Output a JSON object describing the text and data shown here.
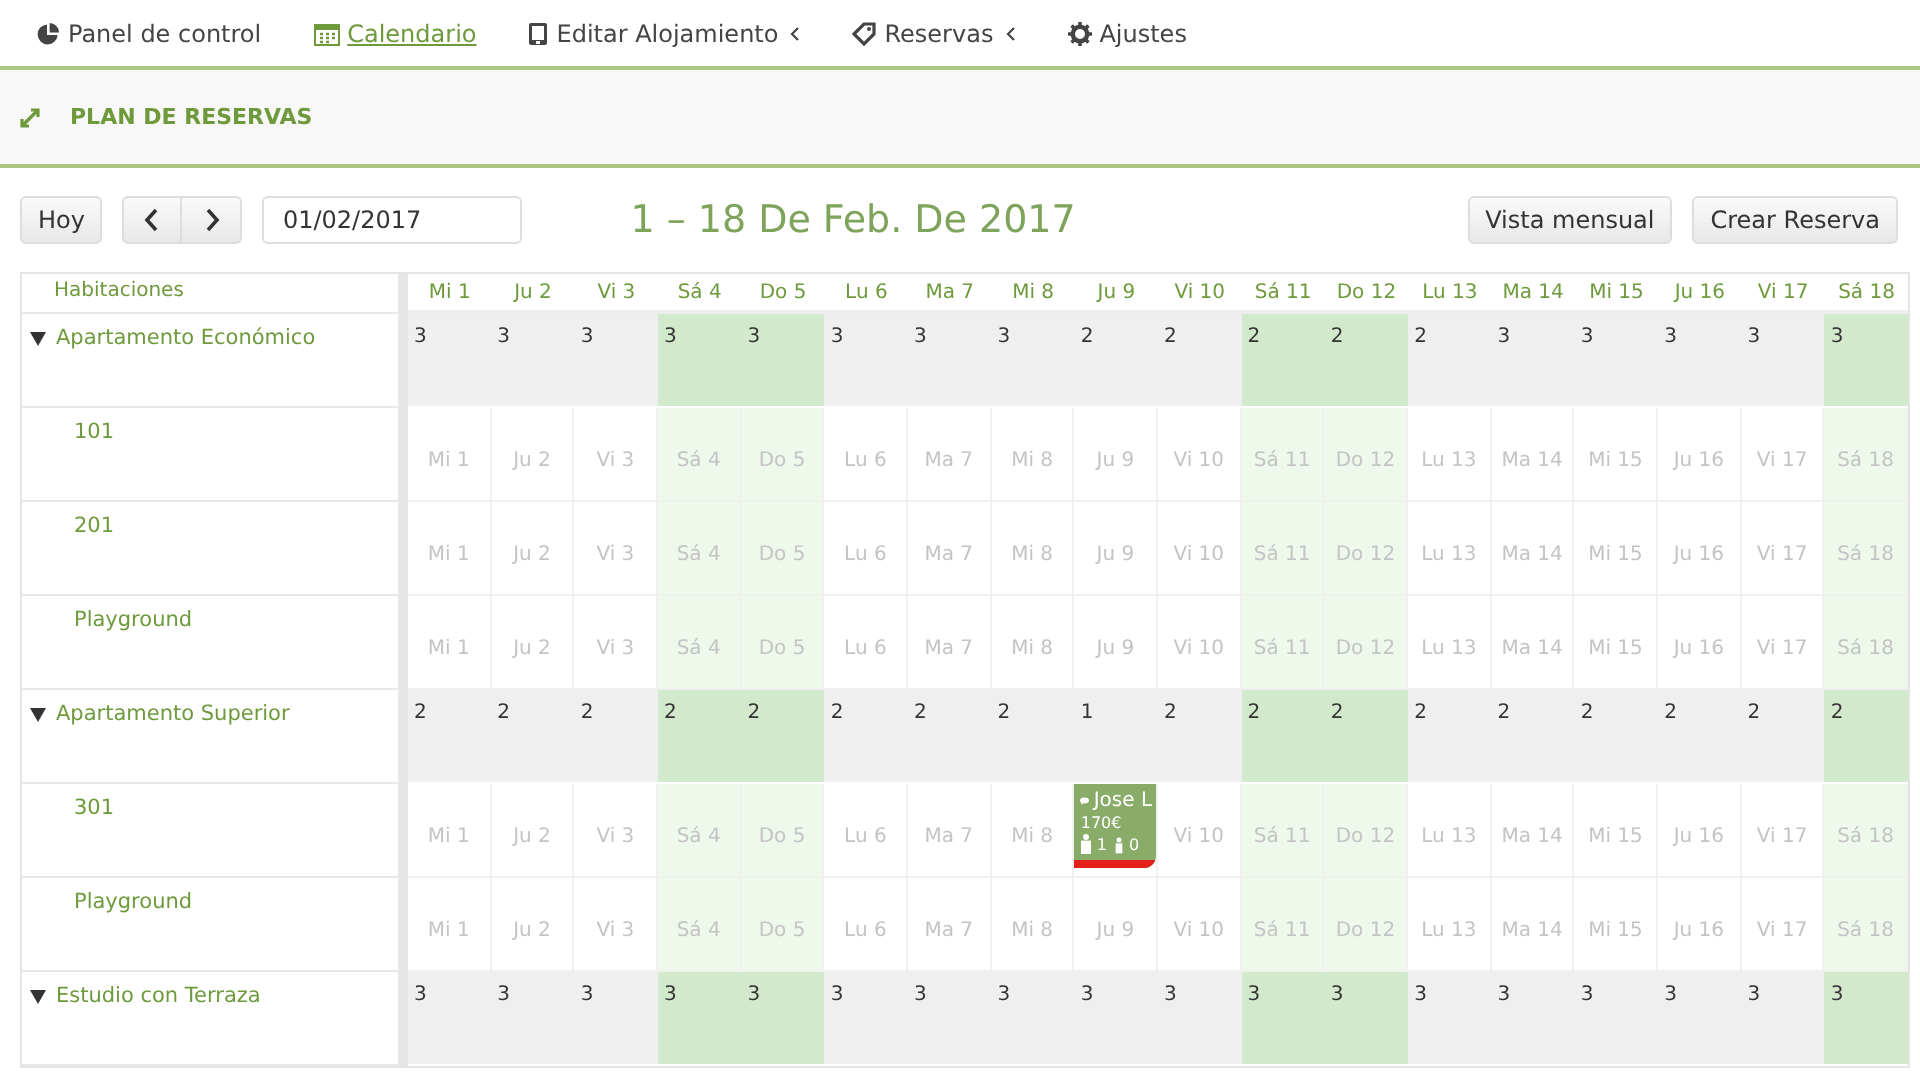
{
  "nav": [
    {
      "label": "Panel de control",
      "selected": false,
      "submenu": false
    },
    {
      "label": "Calendario",
      "selected": true,
      "submenu": false
    },
    {
      "label": "Editar Alojamiento",
      "selected": false,
      "submenu": true
    },
    {
      "label": "Reservas",
      "selected": false,
      "submenu": true
    },
    {
      "label": "Ajustes",
      "selected": false,
      "submenu": false
    }
  ],
  "section_title": "PLAN DE RESERVAS",
  "toolbar": {
    "today": "Hoy",
    "date": "01/02/2017",
    "range": "1 – 18 De Feb. De 2017",
    "buttons": [
      "Vista mensual",
      "Crear Reserva"
    ]
  },
  "rooms_heading": "Habitaciones",
  "days": [
    {
      "label": "Mi 1",
      "weekend": false
    },
    {
      "label": "Ju 2",
      "weekend": false
    },
    {
      "label": "Vi 3",
      "weekend": false
    },
    {
      "label": "Sá 4",
      "weekend": true
    },
    {
      "label": "Do 5",
      "weekend": true
    },
    {
      "label": "Lu 6",
      "weekend": false
    },
    {
      "label": "Ma 7",
      "weekend": false
    },
    {
      "label": "Mi 8",
      "weekend": false
    },
    {
      "label": "Ju 9",
      "weekend": false
    },
    {
      "label": "Vi 10",
      "weekend": false
    },
    {
      "label": "Sá 11",
      "weekend": true
    },
    {
      "label": "Do 12",
      "weekend": true
    },
    {
      "label": "Lu 13",
      "weekend": false
    },
    {
      "label": "Ma 14",
      "weekend": false
    },
    {
      "label": "Mi 15",
      "weekend": false
    },
    {
      "label": "Ju 16",
      "weekend": false
    },
    {
      "label": "Vi 17",
      "weekend": false
    },
    {
      "label": "Sá 18",
      "weekend": true
    }
  ],
  "groups": [
    {
      "name": "Apartamento Económico",
      "expanded": true,
      "availability": [
        "3",
        "3",
        "3",
        "3",
        "3",
        "3",
        "3",
        "3",
        "2",
        "2",
        "2",
        "2",
        "2",
        "3",
        "3",
        "3",
        "3",
        "3"
      ],
      "rooms": [
        {
          "name": "101",
          "cells": [
            {
              "kind": "day",
              "label": "Mi 1"
            },
            {
              "kind": "day",
              "label": "Ju 2"
            },
            {
              "kind": "day",
              "label": "Vi 3"
            },
            {
              "kind": "day",
              "label": "Sá 4"
            },
            {
              "kind": "day",
              "label": "Do 5"
            },
            {
              "kind": "day",
              "label": "Lu 6"
            },
            {
              "kind": "day",
              "label": "Ma 7"
            },
            {
              "kind": "day",
              "label": "Mi 8"
            },
            {
              "kind": "day",
              "label": "Ju 9"
            },
            {
              "kind": "day",
              "label": "Vi 10"
            },
            {
              "kind": "day",
              "label": "Sá 11"
            },
            {
              "kind": "day",
              "label": "Do 12"
            },
            {
              "kind": "day",
              "label": "Lu 13"
            },
            {
              "kind": "day",
              "label": "Ma 14"
            },
            {
              "kind": "day",
              "label": "Mi 15"
            },
            {
              "kind": "day",
              "label": "Ju 16"
            },
            {
              "kind": "day",
              "label": "Vi 17"
            },
            {
              "kind": "day",
              "label": "Sá 18"
            }
          ]
        },
        {
          "name": "201",
          "cells": [
            {
              "kind": "day",
              "label": "Mi 1"
            },
            {
              "kind": "day",
              "label": "Ju 2"
            },
            {
              "kind": "day",
              "label": "Vi 3"
            },
            {
              "kind": "day",
              "label": "Sá 4"
            },
            {
              "kind": "day",
              "label": "Do 5"
            },
            {
              "kind": "day",
              "label": "Lu 6"
            },
            {
              "kind": "day",
              "label": "Ma 7"
            },
            {
              "kind": "day",
              "label": "Mi 8"
            },
            {
              "kind": "day",
              "label": "Ju 9"
            },
            {
              "kind": "day",
              "label": "Vi 10"
            },
            {
              "kind": "day",
              "label": "Sá 11"
            },
            {
              "kind": "day",
              "label": "Do 12"
            },
            {
              "kind": "day",
              "label": "Lu 13"
            },
            {
              "kind": "day",
              "label": "Ma 14"
            },
            {
              "kind": "day",
              "label": "Mi 15"
            },
            {
              "kind": "day",
              "label": "Ju 16"
            },
            {
              "kind": "day",
              "label": "Vi 17"
            },
            {
              "kind": "day",
              "label": "Sá 18"
            }
          ]
        },
        {
          "name": "Playground",
          "cells": [
            {
              "kind": "day",
              "label": "Mi 1"
            },
            {
              "kind": "day",
              "label": "Ju 2"
            },
            {
              "kind": "day",
              "label": "Vi 3"
            },
            {
              "kind": "day",
              "label": "Sá 4"
            },
            {
              "kind": "day",
              "label": "Do 5"
            },
            {
              "kind": "day",
              "label": "Lu 6"
            },
            {
              "kind": "day",
              "label": "Ma 7"
            },
            {
              "kind": "day",
              "label": "Mi 8"
            },
            {
              "kind": "day",
              "label": "Ju 9"
            },
            {
              "kind": "day",
              "label": "Vi 10"
            },
            {
              "kind": "day",
              "label": "Sá 11"
            },
            {
              "kind": "day",
              "label": "Do 12"
            },
            {
              "kind": "day",
              "label": "Lu 13"
            },
            {
              "kind": "day",
              "label": "Ma 14"
            },
            {
              "kind": "day",
              "label": "Mi 15"
            },
            {
              "kind": "day",
              "label": "Ju 16"
            },
            {
              "kind": "day",
              "label": "Vi 17"
            },
            {
              "kind": "day",
              "label": "Sá 18"
            }
          ]
        }
      ]
    },
    {
      "name": "Apartamento Superior",
      "expanded": true,
      "availability": [
        "2",
        "2",
        "2",
        "2",
        "2",
        "2",
        "2",
        "2",
        "1",
        "2",
        "2",
        "2",
        "2",
        "2",
        "2",
        "2",
        "2",
        "2"
      ],
      "rooms": [
        {
          "name": "301",
          "cells": [
            {
              "kind": "day",
              "label": "Mi 1"
            },
            {
              "kind": "day",
              "label": "Ju 2"
            },
            {
              "kind": "day",
              "label": "Vi 3"
            },
            {
              "kind": "day",
              "label": "Sá 4"
            },
            {
              "kind": "day",
              "label": "Do 5"
            },
            {
              "kind": "day",
              "label": "Lu 6"
            },
            {
              "kind": "day",
              "label": "Ma 7"
            },
            {
              "kind": "day",
              "label": "Mi 8"
            },
            {
              "kind": "booking",
              "guest": "Jose L",
              "price": "170€",
              "adults": "1",
              "children": "0"
            },
            {
              "kind": "day",
              "label": "Vi 10"
            },
            {
              "kind": "day",
              "label": "Sá 11"
            },
            {
              "kind": "day",
              "label": "Do 12"
            },
            {
              "kind": "day",
              "label": "Lu 13"
            },
            {
              "kind": "day",
              "label": "Ma 14"
            },
            {
              "kind": "day",
              "label": "Mi 15"
            },
            {
              "kind": "day",
              "label": "Ju 16"
            },
            {
              "kind": "day",
              "label": "Vi 17"
            },
            {
              "kind": "day",
              "label": "Sá 18"
            }
          ]
        },
        {
          "name": "Playground",
          "cells": [
            {
              "kind": "day",
              "label": "Mi 1"
            },
            {
              "kind": "day",
              "label": "Ju 2"
            },
            {
              "kind": "day",
              "label": "Vi 3"
            },
            {
              "kind": "day",
              "label": "Sá 4"
            },
            {
              "kind": "day",
              "label": "Do 5"
            },
            {
              "kind": "day",
              "label": "Lu 6"
            },
            {
              "kind": "day",
              "label": "Ma 7"
            },
            {
              "kind": "day",
              "label": "Mi 8"
            },
            {
              "kind": "day",
              "label": "Ju 9"
            },
            {
              "kind": "day",
              "label": "Vi 10"
            },
            {
              "kind": "day",
              "label": "Sá 11"
            },
            {
              "kind": "day",
              "label": "Do 12"
            },
            {
              "kind": "day",
              "label": "Lu 13"
            },
            {
              "kind": "day",
              "label": "Ma 14"
            },
            {
              "kind": "day",
              "label": "Mi 15"
            },
            {
              "kind": "day",
              "label": "Ju 16"
            },
            {
              "kind": "day",
              "label": "Vi 17"
            },
            {
              "kind": "day",
              "label": "Sá 18"
            }
          ]
        }
      ]
    },
    {
      "name": "Estudio con Terraza",
      "expanded": true,
      "availability": [
        "3",
        "3",
        "3",
        "3",
        "3",
        "3",
        "3",
        "3",
        "3",
        "3",
        "3",
        "3",
        "3",
        "3",
        "3",
        "3",
        "3",
        "3"
      ]
    }
  ]
}
